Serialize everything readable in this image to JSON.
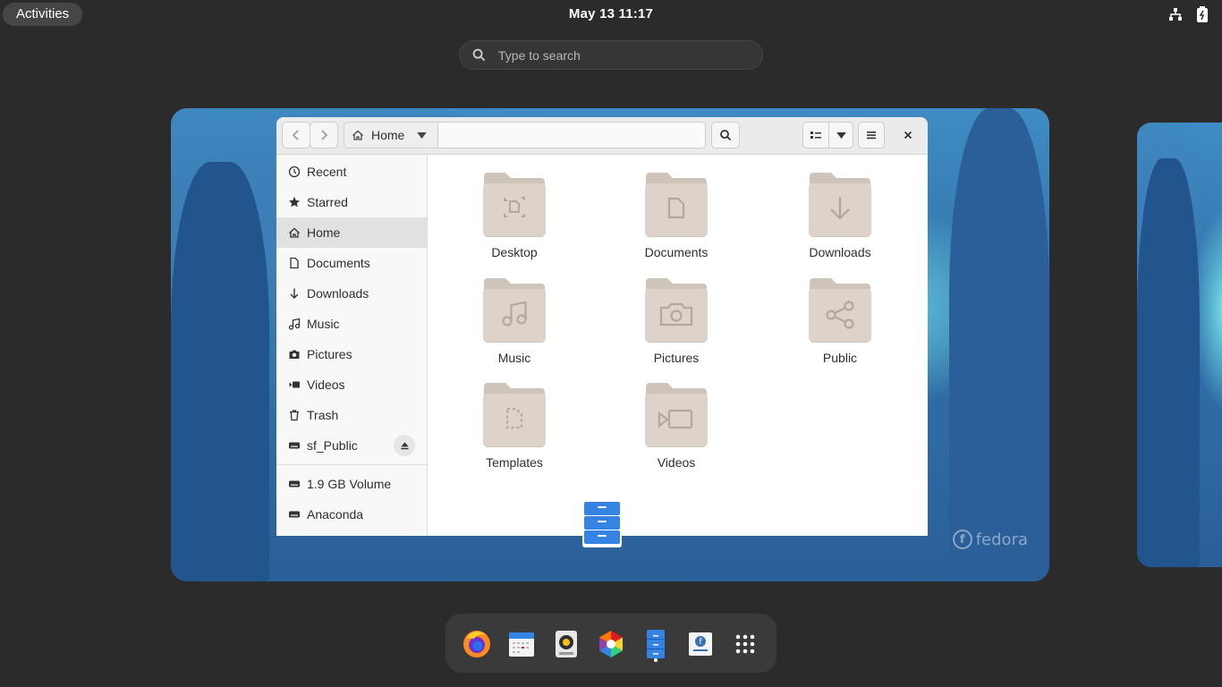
{
  "topbar": {
    "activities_label": "Activities",
    "clock": "May 13  11:17",
    "tray_icons": [
      "network-wired-icon",
      "battery-icon"
    ]
  },
  "search": {
    "placeholder": "Type to search"
  },
  "files_window": {
    "path_label": "Home",
    "sidebar": {
      "places": [
        {
          "label": "Recent",
          "icon": "clock-icon"
        },
        {
          "label": "Starred",
          "icon": "star-icon"
        },
        {
          "label": "Home",
          "icon": "home-icon",
          "active": true
        },
        {
          "label": "Documents",
          "icon": "document-icon"
        },
        {
          "label": "Downloads",
          "icon": "download-icon"
        },
        {
          "label": "Music",
          "icon": "music-icon"
        },
        {
          "label": "Pictures",
          "icon": "camera-icon"
        },
        {
          "label": "Videos",
          "icon": "video-icon"
        },
        {
          "label": "Trash",
          "icon": "trash-icon"
        },
        {
          "label": "sf_Public",
          "icon": "drive-icon"
        }
      ],
      "devices": [
        {
          "label": "1.9 GB Volume",
          "icon": "drive-icon"
        },
        {
          "label": "Anaconda",
          "icon": "drive-icon"
        }
      ]
    },
    "folders": [
      {
        "label": "Desktop",
        "icon": "desktop-folder-icon"
      },
      {
        "label": "Documents",
        "icon": "documents-folder-icon"
      },
      {
        "label": "Downloads",
        "icon": "downloads-folder-icon"
      },
      {
        "label": "Music",
        "icon": "music-folder-icon"
      },
      {
        "label": "Pictures",
        "icon": "pictures-folder-icon"
      },
      {
        "label": "Public",
        "icon": "public-folder-icon"
      },
      {
        "label": "Templates",
        "icon": "templates-folder-icon"
      },
      {
        "label": "Videos",
        "icon": "videos-folder-icon"
      }
    ]
  },
  "wallpaper_brand": "fedora",
  "dash": {
    "apps": [
      "firefox-icon",
      "calendar-icon",
      "rhythmbox-icon",
      "software-icon",
      "files-icon",
      "fedora-media-writer-icon",
      "show-apps-icon"
    ]
  },
  "colors": {
    "panel_bg": "#2b2b2b",
    "accent": "#3584e4",
    "folder": "#d9cfc6"
  }
}
